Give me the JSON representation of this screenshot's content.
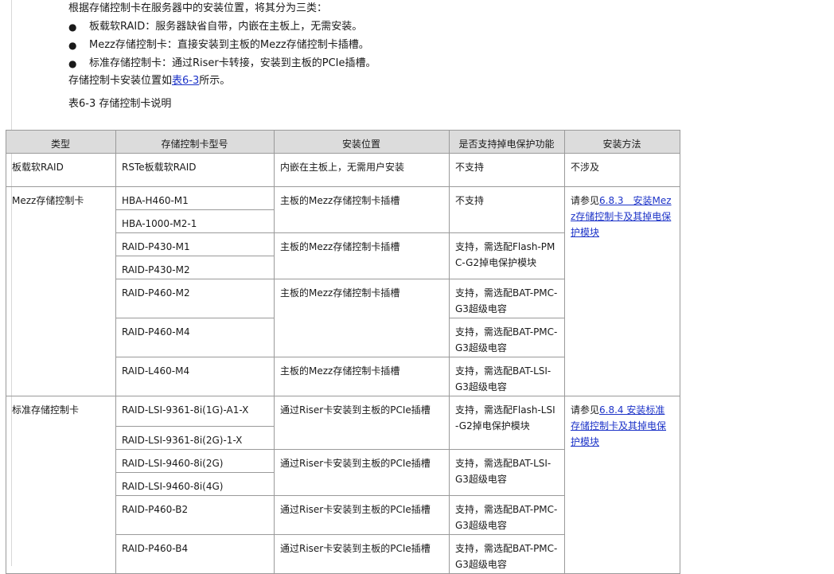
{
  "intro": {
    "lead": "根据存储控制卡在服务器中的安装位置，将其分为三类：",
    "bullets": [
      "板载软RAID：服务器缺省自带，内嵌在主板上，无需安装。",
      "Mezz存储控制卡：直接安装到主板的Mezz存储控制卡插槽。",
      "标准存储控制卡：通过Riser卡转接，安装到主板的PCIe插槽。"
    ],
    "ref_prefix": "存储控制卡安装位置如",
    "ref_link": "表6-3",
    "ref_suffix": "所示。"
  },
  "table": {
    "caption": "表6-3 存储控制卡说明",
    "headers": [
      "类型",
      "存储控制卡型号",
      "安装位置",
      "是否支持掉电保护功能",
      "安装方法"
    ],
    "onboard": {
      "type": "板载软RAID",
      "model": "RSTe板载软RAID",
      "location": "内嵌在主板上，无需用户安装",
      "protection": "不支持",
      "method": "不涉及"
    },
    "mezz": {
      "type": "Mezz存储控制卡",
      "method_prefix": "请参见",
      "method_link": "6.8.3　安装Mezz存储控制卡及其掉电保护模块",
      "location": "主板的Mezz存储控制卡插槽",
      "models": [
        "HBA-H460-M1",
        "HBA-1000-M2-1",
        "RAID-P430-M1",
        "RAID-P430-M2",
        "RAID-P460-M2",
        "RAID-P460-M4",
        "RAID-L460-M4"
      ],
      "protection": [
        "不支持",
        "支持，需选配Flash-PMC-G2掉电保护模块",
        "支持，需选配BAT-PMC-G3超级电容",
        "支持，需选配BAT-PMC-G3超级电容",
        "支持，需选配BAT-LSI-G3超级电容"
      ]
    },
    "standard": {
      "type": "标准存储控制卡",
      "method_prefix": "请参见",
      "method_link": "6.8.4 安装标准存储控制卡及其掉电保护模块",
      "location": "通过Riser卡安装到主板的PCIe插槽",
      "models": [
        "RAID-LSI-9361-8i(1G)-A1-X",
        "RAID-LSI-9361-8i(2G)-1-X",
        "RAID-LSI-9460-8i(2G)",
        "RAID-LSI-9460-8i(4G)",
        "RAID-P460-B2",
        "RAID-P460-B4"
      ],
      "protection": [
        "支持，需选配Flash-LSI-G2掉电保护模块",
        "支持，需选配BAT-LSI-G3超级电容",
        "支持，需选配BAT-PMC-G3超级电容",
        "支持，需选配BAT-PMC-G3超级电容"
      ]
    }
  }
}
